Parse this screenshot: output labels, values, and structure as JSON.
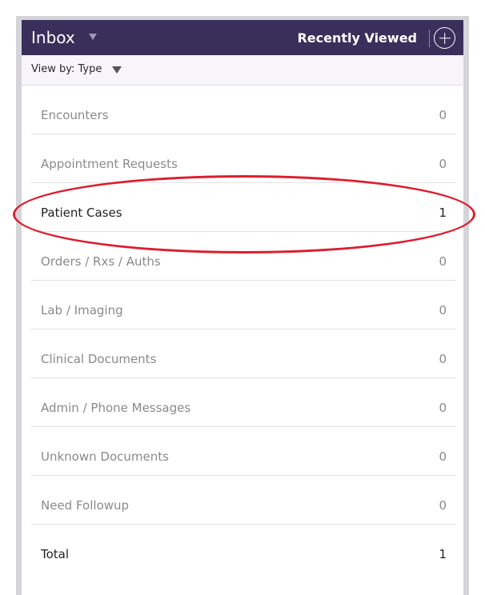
{
  "header": {
    "title": "Inbox",
    "recently_viewed": "Recently Viewed"
  },
  "viewby": {
    "label": "View by: Type"
  },
  "rows": [
    {
      "label": "Encounters",
      "count": "0"
    },
    {
      "label": "Appointment Requests",
      "count": "0"
    },
    {
      "label": "Patient Cases",
      "count": "1"
    },
    {
      "label": "Orders / Rxs / Auths",
      "count": "0"
    },
    {
      "label": "Lab / Imaging",
      "count": "0"
    },
    {
      "label": "Clinical Documents",
      "count": "0"
    },
    {
      "label": "Admin / Phone Messages",
      "count": "0"
    },
    {
      "label": "Unknown Documents",
      "count": "0"
    },
    {
      "label": "Need Followup",
      "count": "0"
    },
    {
      "label": "Total",
      "count": "1"
    }
  ],
  "colors": {
    "header_bg": "#3a2f5a",
    "highlight": "#dd1d2e"
  }
}
